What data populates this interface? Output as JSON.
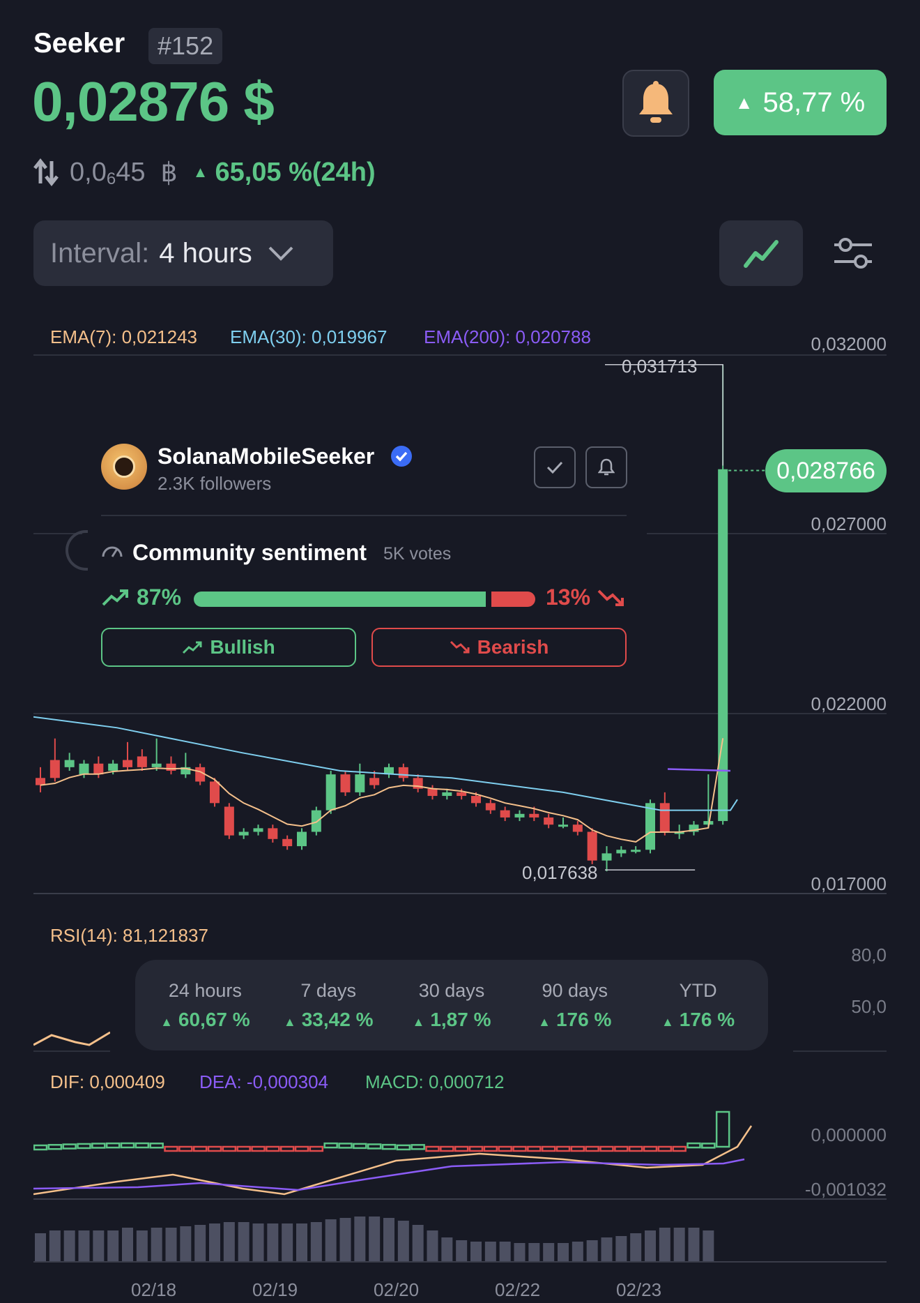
{
  "coin": {
    "name": "Seeker",
    "rank": "#152",
    "price": "0,02876 $",
    "change_badge": "58,77 %",
    "btc_price_prefix": "0,0",
    "btc_price_sub": "6",
    "btc_price_suffix": "45",
    "btc_symbol": "฿",
    "change_24h": "65,05 %(24h)"
  },
  "controls": {
    "interval_label": "Interval:",
    "interval_value": "4 hours"
  },
  "ema": {
    "ema7": "EMA(7): 0,021243",
    "ema30": "EMA(30): 0,019967",
    "ema200": "EMA(200): 0,020788"
  },
  "price_axis": [
    "0,032000",
    "0,027000",
    "0,022000",
    "0,017000"
  ],
  "annotations": {
    "high": "0,031713",
    "low": "0,017638",
    "current": "0,028766"
  },
  "profile": {
    "name": "SolanaMobileSeeker",
    "followers": "2.3K followers"
  },
  "sentiment": {
    "title": "Community sentiment",
    "votes": "5K votes",
    "bull_pct": "87%",
    "bear_pct": "13%",
    "bull_fraction": 0.87,
    "bullish_label": "Bullish",
    "bearish_label": "Bearish"
  },
  "rsi": {
    "label": "RSI(14): 81,121837",
    "axis": [
      "80,0",
      "50,0"
    ]
  },
  "performance": [
    {
      "period": "24 hours",
      "value": "60,67 %"
    },
    {
      "period": "7 days",
      "value": "33,42 %"
    },
    {
      "period": "30 days",
      "value": "1,87 %"
    },
    {
      "period": "90 days",
      "value": "176 %"
    },
    {
      "period": "YTD",
      "value": "176 %"
    }
  ],
  "macd": {
    "dif": "DIF: 0,000409",
    "dea": "DEA: -0,000304",
    "macd": "MACD: 0,000712",
    "axis": [
      "0,000000",
      "-0,001032"
    ]
  },
  "dates": [
    "02/18",
    "02/19",
    "02/20",
    "02/22",
    "02/23"
  ],
  "colors": {
    "up": "#5cc586",
    "down": "#e04b4b",
    "ema7": "#f5c08b",
    "ema30": "#7fcfef",
    "ema200": "#8b5cf6",
    "background": "#171924"
  }
}
